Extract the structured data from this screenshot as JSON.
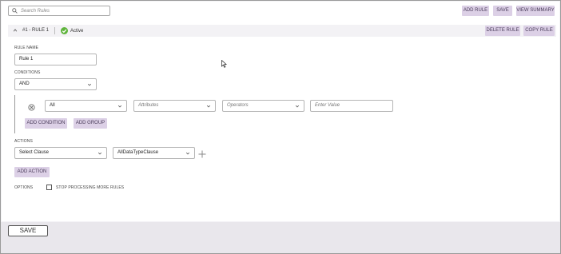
{
  "search": {
    "placeholder": "Search Rules"
  },
  "toolbar": {
    "add_rule": "ADD RULE",
    "save": "SAVE",
    "view_summary": "VIEW SUMMARY"
  },
  "rule": {
    "title": "#1 - RULE 1",
    "status": "Active",
    "delete": "DELETE RULE",
    "copy": "COPY RULE",
    "name_label": "RULE NAME",
    "name_value": "Rule 1",
    "conditions_label": "CONDITIONS",
    "conditions_value": "AND",
    "condition": {
      "field": "All",
      "attributes": "Attributes",
      "operators": "Operators",
      "value": "Enter Value"
    },
    "add_condition": "ADD CONDITION",
    "add_group": "ADD GROUP",
    "actions_label": "ACTIONS",
    "action": {
      "clause": "Select Clause",
      "type": "AllDataTypeClause"
    },
    "add_action": "ADD ACTION",
    "options_label": "OPTIONS",
    "stop_processing": "STOP PROCESSING MORE RULES"
  },
  "footer": {
    "save": "SAVE"
  },
  "colors": {
    "accent": "#dcd0e6",
    "status": "#5fb43c"
  }
}
